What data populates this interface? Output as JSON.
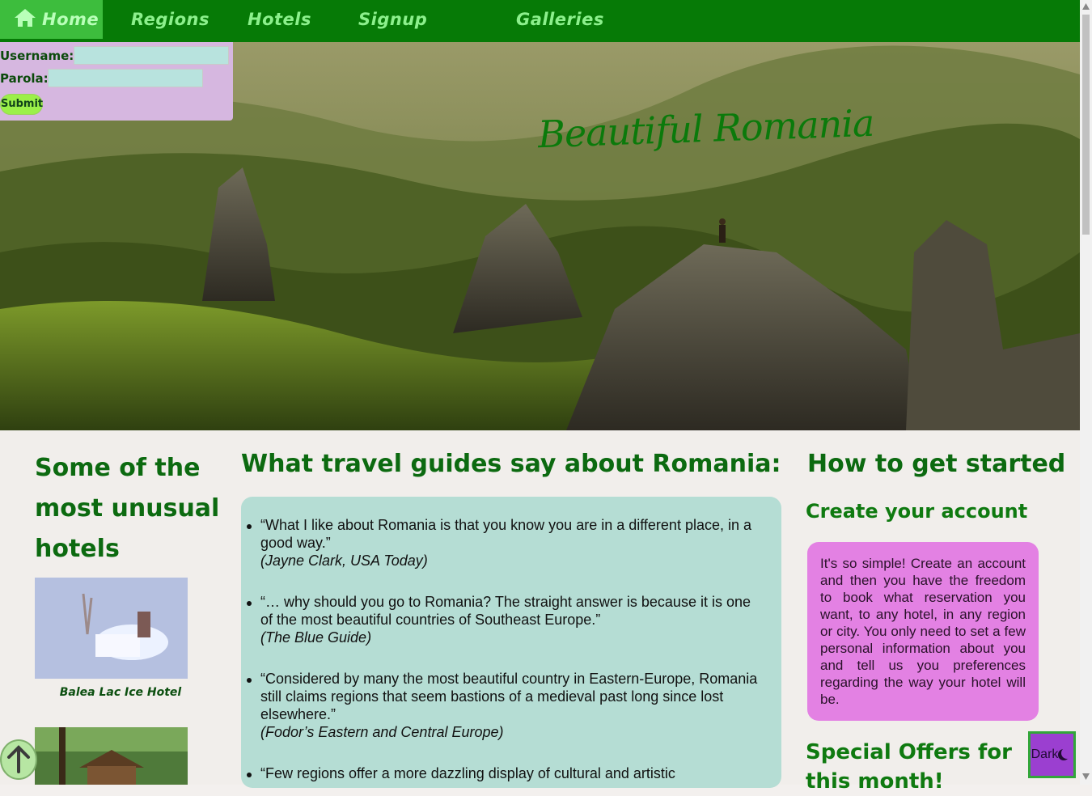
{
  "nav": {
    "items": [
      {
        "label": "Home",
        "icon": "home-icon",
        "active": true
      },
      {
        "label": "Regions"
      },
      {
        "label": "Hotels"
      },
      {
        "label": "Signup"
      },
      {
        "label": "Galleries"
      }
    ]
  },
  "hero": {
    "title": "Beautiful Romania"
  },
  "login": {
    "username_label": "Username:",
    "password_label": "Parola:",
    "submit_label": "Submit"
  },
  "left": {
    "title": "Some of the most unusual hotels",
    "hotels": [
      {
        "caption": "Balea Lac Ice Hotel"
      },
      {
        "caption": ""
      }
    ]
  },
  "middle": {
    "title": "What travel guides say about Romania:",
    "quotes": [
      {
        "text": "“What I like about Romania is that you know you are in a different place, in a good way.”",
        "source": "(Jayne Clark, USA Today)"
      },
      {
        "text": "“… why should you go to Romania? The straight answer is because it is one of the most beautiful countries of Southeast Europe.”",
        "source": "(The Blue Guide)"
      },
      {
        "text": "“Considered by many the most beautiful country in Eastern-Europe, Romania still claims regions that seem bastions of a medieval past long since lost elsewhere.”",
        "source": "(Fodor’s Eastern and Central Europe)"
      },
      {
        "text": "“Few regions offer a more dazzling display of cultural and artistic",
        "source": ""
      }
    ]
  },
  "right": {
    "title": "How to get started",
    "subtitle": "Create your account",
    "body": "It's so simple! Create an account and then you have the freedom to book what reservation you want, to any hotel, in any region or city. You only need to set a few personal information about you and tell us you preferences regarding the way your hotel will be.",
    "offers_title": "Special Offers for this month!"
  },
  "dark_button": {
    "label": "Dark",
    "icon": "moon-icon"
  },
  "back_to_top": {
    "icon": "arrow-up-icon"
  },
  "colors": {
    "nav": "#067a06",
    "accent": "#0c6a10",
    "quotes_bg": "#b5ddd4",
    "start_bg": "#e381e3",
    "login_bg": "#d6b7e0"
  }
}
